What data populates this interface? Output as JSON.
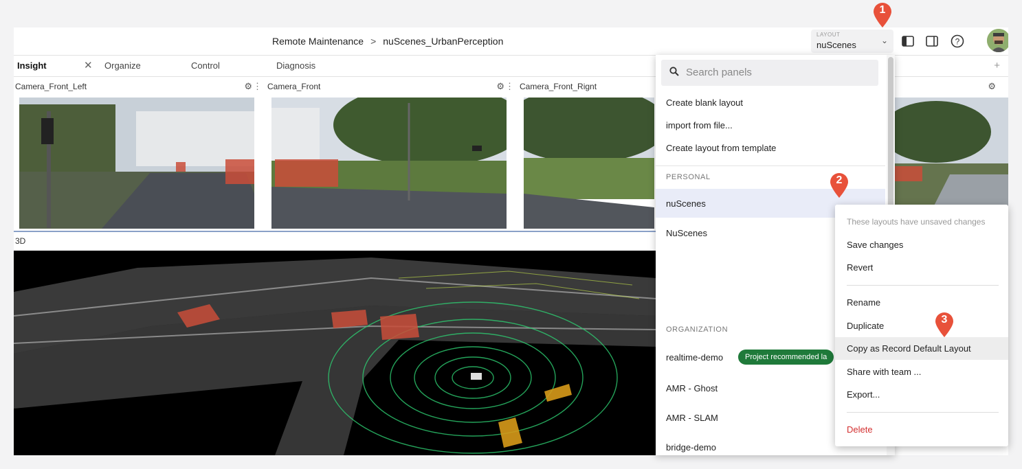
{
  "breadcrumb": {
    "project": "Remote Maintenance",
    "separator": ">",
    "recording": "nuScenes_UrbanPerception"
  },
  "layout": {
    "label": "LAYOUT",
    "value": "nuScenes"
  },
  "toolbar_icons": [
    "left-sidebar-icon",
    "right-sidebar-icon",
    "help-icon",
    "user-avatar"
  ],
  "tabs": [
    {
      "label": "Insight",
      "active": true
    },
    {
      "label": "Organize"
    },
    {
      "label": "Control"
    },
    {
      "label": "Diagnosis"
    }
  ],
  "panels": {
    "cam_left": "Camera_Front_Left",
    "cam_front": "Camera_Front",
    "cam_right": "Camera_Front_Rignt",
    "view3d": "3D"
  },
  "dropdown": {
    "search_placeholder": "Search panels",
    "actions": [
      "Create blank layout",
      "import from file...",
      "Create layout from template"
    ],
    "personal_header": "PERSONAL",
    "personal": [
      "nuScenes",
      "NuScenes"
    ],
    "organization_header": "ORGANIZATION",
    "organization": [
      "realtime-demo",
      "AMR - Ghost",
      "AMR - SLAM",
      "bridge-demo"
    ],
    "badge": "Project recommended la"
  },
  "context_menu": {
    "note": "These layouts have unsaved changes",
    "items": [
      "Save changes",
      "Revert",
      "Rename",
      "Duplicate",
      "Copy as Record Default Layout",
      "Share with team ...",
      "Export...",
      "Delete"
    ]
  },
  "steps": [
    "1",
    "2",
    "3"
  ],
  "colors": {
    "accent": "#e8513a",
    "badge": "#1f7a3a",
    "danger": "#d32f2f",
    "highlight": "#e9ecf8"
  }
}
